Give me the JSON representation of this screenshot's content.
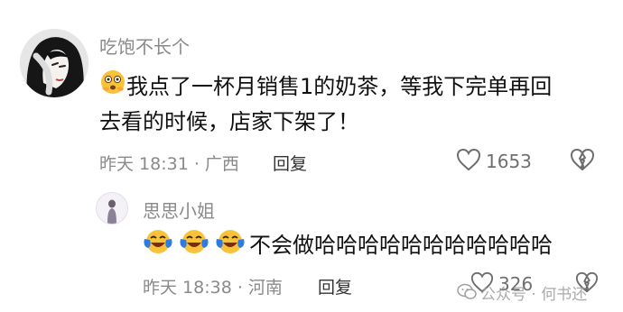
{
  "comment": {
    "username": "吃饱不长个",
    "line1": "我点了一杯月销售1的奶茶，等我下完单再回",
    "line2": "去看的时候，店家下架了！",
    "emoji": "flushed-emoji",
    "time_location": "昨天 18:31 · 广西",
    "reply_label": "回复",
    "like_count": "1653"
  },
  "reply": {
    "username": "思思小姐",
    "text": "不会做哈哈哈哈哈哈哈哈哈哈哈",
    "emoji": "laughing-crying-emoji",
    "time_location": "昨天 18:38 · 河南",
    "reply_label": "回复",
    "like_count": "326"
  },
  "watermark": "公众号 · 何书还",
  "colors": {
    "text_primary": "#111111",
    "text_secondary": "#8a8a8a",
    "emoji_yellow": "#f8c33a",
    "emoji_blue": "#2d7be3"
  }
}
